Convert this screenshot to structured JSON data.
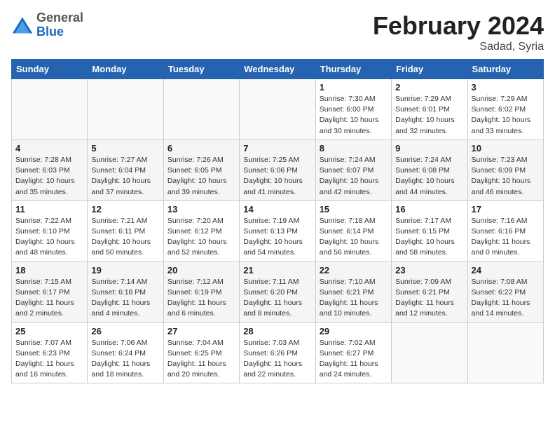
{
  "header": {
    "logo_general": "General",
    "logo_blue": "Blue",
    "title": "February 2024",
    "subtitle": "Sadad, Syria"
  },
  "days_of_week": [
    "Sunday",
    "Monday",
    "Tuesday",
    "Wednesday",
    "Thursday",
    "Friday",
    "Saturday"
  ],
  "weeks": [
    [
      {
        "num": "",
        "detail": ""
      },
      {
        "num": "",
        "detail": ""
      },
      {
        "num": "",
        "detail": ""
      },
      {
        "num": "",
        "detail": ""
      },
      {
        "num": "1",
        "detail": "Sunrise: 7:30 AM\nSunset: 6:00 PM\nDaylight: 10 hours\nand 30 minutes."
      },
      {
        "num": "2",
        "detail": "Sunrise: 7:29 AM\nSunset: 6:01 PM\nDaylight: 10 hours\nand 32 minutes."
      },
      {
        "num": "3",
        "detail": "Sunrise: 7:29 AM\nSunset: 6:02 PM\nDaylight: 10 hours\nand 33 minutes."
      }
    ],
    [
      {
        "num": "4",
        "detail": "Sunrise: 7:28 AM\nSunset: 6:03 PM\nDaylight: 10 hours\nand 35 minutes."
      },
      {
        "num": "5",
        "detail": "Sunrise: 7:27 AM\nSunset: 6:04 PM\nDaylight: 10 hours\nand 37 minutes."
      },
      {
        "num": "6",
        "detail": "Sunrise: 7:26 AM\nSunset: 6:05 PM\nDaylight: 10 hours\nand 39 minutes."
      },
      {
        "num": "7",
        "detail": "Sunrise: 7:25 AM\nSunset: 6:06 PM\nDaylight: 10 hours\nand 41 minutes."
      },
      {
        "num": "8",
        "detail": "Sunrise: 7:24 AM\nSunset: 6:07 PM\nDaylight: 10 hours\nand 42 minutes."
      },
      {
        "num": "9",
        "detail": "Sunrise: 7:24 AM\nSunset: 6:08 PM\nDaylight: 10 hours\nand 44 minutes."
      },
      {
        "num": "10",
        "detail": "Sunrise: 7:23 AM\nSunset: 6:09 PM\nDaylight: 10 hours\nand 46 minutes."
      }
    ],
    [
      {
        "num": "11",
        "detail": "Sunrise: 7:22 AM\nSunset: 6:10 PM\nDaylight: 10 hours\nand 48 minutes."
      },
      {
        "num": "12",
        "detail": "Sunrise: 7:21 AM\nSunset: 6:11 PM\nDaylight: 10 hours\nand 50 minutes."
      },
      {
        "num": "13",
        "detail": "Sunrise: 7:20 AM\nSunset: 6:12 PM\nDaylight: 10 hours\nand 52 minutes."
      },
      {
        "num": "14",
        "detail": "Sunrise: 7:19 AM\nSunset: 6:13 PM\nDaylight: 10 hours\nand 54 minutes."
      },
      {
        "num": "15",
        "detail": "Sunrise: 7:18 AM\nSunset: 6:14 PM\nDaylight: 10 hours\nand 56 minutes."
      },
      {
        "num": "16",
        "detail": "Sunrise: 7:17 AM\nSunset: 6:15 PM\nDaylight: 10 hours\nand 58 minutes."
      },
      {
        "num": "17",
        "detail": "Sunrise: 7:16 AM\nSunset: 6:16 PM\nDaylight: 11 hours\nand 0 minutes."
      }
    ],
    [
      {
        "num": "18",
        "detail": "Sunrise: 7:15 AM\nSunset: 6:17 PM\nDaylight: 11 hours\nand 2 minutes."
      },
      {
        "num": "19",
        "detail": "Sunrise: 7:14 AM\nSunset: 6:18 PM\nDaylight: 11 hours\nand 4 minutes."
      },
      {
        "num": "20",
        "detail": "Sunrise: 7:12 AM\nSunset: 6:19 PM\nDaylight: 11 hours\nand 6 minutes."
      },
      {
        "num": "21",
        "detail": "Sunrise: 7:11 AM\nSunset: 6:20 PM\nDaylight: 11 hours\nand 8 minutes."
      },
      {
        "num": "22",
        "detail": "Sunrise: 7:10 AM\nSunset: 6:21 PM\nDaylight: 11 hours\nand 10 minutes."
      },
      {
        "num": "23",
        "detail": "Sunrise: 7:09 AM\nSunset: 6:21 PM\nDaylight: 11 hours\nand 12 minutes."
      },
      {
        "num": "24",
        "detail": "Sunrise: 7:08 AM\nSunset: 6:22 PM\nDaylight: 11 hours\nand 14 minutes."
      }
    ],
    [
      {
        "num": "25",
        "detail": "Sunrise: 7:07 AM\nSunset: 6:23 PM\nDaylight: 11 hours\nand 16 minutes."
      },
      {
        "num": "26",
        "detail": "Sunrise: 7:06 AM\nSunset: 6:24 PM\nDaylight: 11 hours\nand 18 minutes."
      },
      {
        "num": "27",
        "detail": "Sunrise: 7:04 AM\nSunset: 6:25 PM\nDaylight: 11 hours\nand 20 minutes."
      },
      {
        "num": "28",
        "detail": "Sunrise: 7:03 AM\nSunset: 6:26 PM\nDaylight: 11 hours\nand 22 minutes."
      },
      {
        "num": "29",
        "detail": "Sunrise: 7:02 AM\nSunset: 6:27 PM\nDaylight: 11 hours\nand 24 minutes."
      },
      {
        "num": "",
        "detail": ""
      },
      {
        "num": "",
        "detail": ""
      }
    ]
  ]
}
